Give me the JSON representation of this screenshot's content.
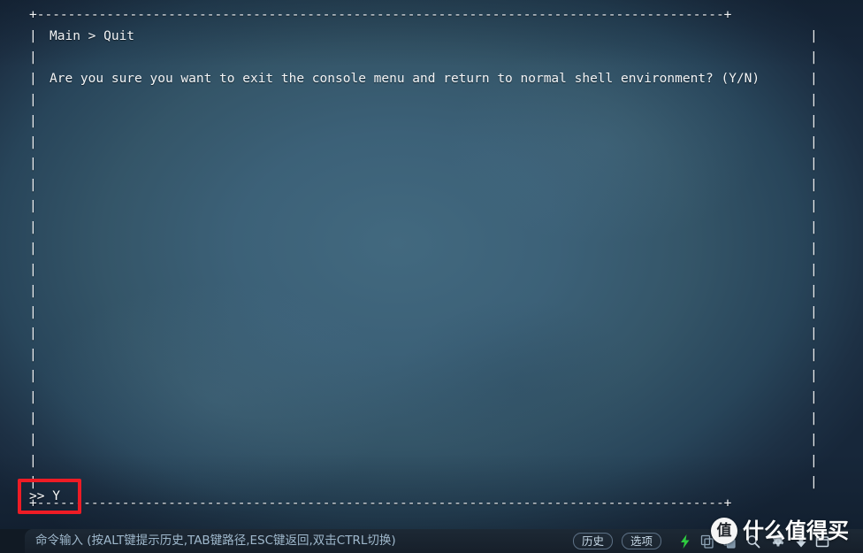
{
  "console": {
    "breadcrumb": "Main > Quit",
    "question": "Are you sure you want to exit the console menu and return to normal shell environment? (Y/N)",
    "border_corner": "+",
    "border_dash": "-",
    "border_pipe": "|",
    "top_border": "+-----------------------------------------------------------------------------------------+",
    "bottom_border": "+-----------------------------------------------------------------------------------------+",
    "prompt_symbol": ">>",
    "prompt_value": "Y",
    "prompt_line": ">> Y",
    "blank_rows": 17,
    "text_color": "#f2f4f6",
    "background_color": "#3c6178"
  },
  "annotation": {
    "target": "prompt-line",
    "color": "#ee1c25",
    "shape": "rectangle"
  },
  "toolbar": {
    "hint": "命令输入 (按ALT键提示历史,TAB键路径,ESC键返回,双击CTRL切换)",
    "buttons": [
      {
        "label": "历史",
        "name": "history"
      },
      {
        "label": "选项",
        "name": "options"
      }
    ],
    "icons": [
      {
        "name": "lightning-bolt-icon",
        "color": "#2ecc40"
      },
      {
        "name": "copy-icon",
        "color": "#8fa4b6"
      },
      {
        "name": "paste-icon",
        "color": "#8fa4b6"
      },
      {
        "name": "search-icon",
        "color": "#cdd9e4"
      },
      {
        "name": "gear-icon",
        "color": "#cdd9e4"
      },
      {
        "name": "download-arrow-icon",
        "color": "#cdd9e4"
      },
      {
        "name": "window-icon",
        "color": "#cdd9e4"
      }
    ],
    "background_color": "#161f2a"
  },
  "watermark": {
    "badge": "值",
    "text": "什么值得买"
  }
}
